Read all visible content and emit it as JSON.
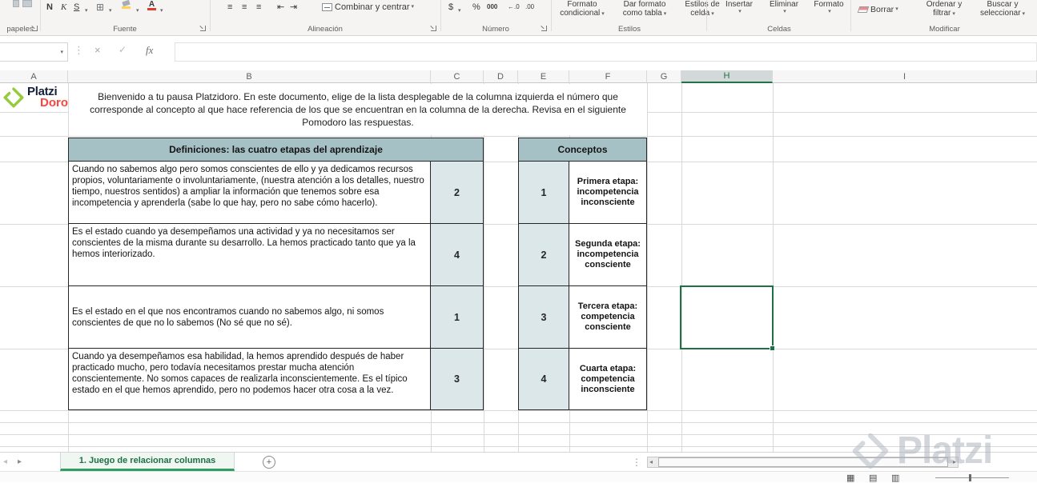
{
  "ribbon": {
    "groups": {
      "clipboard": "papeles",
      "font": "Fuente",
      "alignment": "Alineación",
      "number": "Número",
      "styles": "Estilos",
      "cells": "Celdas",
      "editing": "Modificar"
    },
    "buttons": {
      "bold": "N",
      "italic": "K",
      "underline": "S",
      "merge_center": "Combinar y centrar",
      "currency": "$",
      "percent": "%",
      "thousands": "000",
      "conditional_formatting": "Formato condicional",
      "format_as_table": "Dar formato como tabla",
      "cell_styles": "Estilos de celda",
      "insert": "Insertar",
      "delete": "Eliminar",
      "format": "Formato",
      "clear": "Borrar",
      "sort_filter": "Ordenar y filtrar",
      "find_select": "Buscar y seleccionar"
    }
  },
  "formula_bar": {
    "name_box_value": "",
    "formula_value": "",
    "insert_function": "fx"
  },
  "icons": {
    "dropdown": "▾",
    "cancel": "×",
    "enter": "✓",
    "borders": "⊞",
    "align_lines": "≡",
    "indent_decrease": "⇤",
    "indent_increase": "⇥",
    "increase_decimal": "←.0",
    "decrease_decimal": ".00",
    "font_color_letter": "A",
    "nav_left": "◂",
    "nav_right": "▸",
    "scroll_left": "◂",
    "scroll_right": "▸",
    "add_sheet": "+",
    "splitter": "⋮",
    "view_normal": "▦",
    "view_layout": "▤",
    "view_break": "▥"
  },
  "column_headers": [
    "A",
    "B",
    "C",
    "D",
    "E",
    "F",
    "G",
    "H",
    "I"
  ],
  "selection": {
    "column": "H"
  },
  "logo": {
    "brand": "Platzi",
    "product": "Doro"
  },
  "instructions": "Bienvenido a tu pausa Platzidoro. En este documento, elige de la lista desplegable de la columna izquierda el número que corresponde al concepto al que hace referencia de los que se encuentran en la columna de la derecha. Revisa en el siguiente Pomodoro las respuestas.",
  "definitions_table": {
    "title": "Definiciones: las cuatro etapas del aprendizaje",
    "rows": [
      {
        "definition": "Cuando no sabemos algo pero somos conscientes de ello y ya dedicamos recursos propios, voluntariamente o involuntariamente, (nuestra atención a los detalles, nuestro tiempo, nuestros sentidos) a ampliar la información que tenemos sobre esa incompetencia y aprenderla (sabe lo que hay, pero no sabe cómo hacerlo).",
        "answer": "2"
      },
      {
        "definition": "Es el estado cuando ya desempeñamos una actividad y ya no necesitamos ser conscientes de la misma durante su desarrollo. La hemos practicado tanto que ya la hemos interiorizado.",
        "answer": "4"
      },
      {
        "definition": "Es el estado en el que nos encontramos cuando no sabemos algo, ni somos conscientes de que no lo sabemos (No sé que no sé).",
        "answer": "1"
      },
      {
        "definition": "Cuando ya desempeñamos esa habilidad, la hemos aprendido después de haber practicado mucho, pero todavía necesitamos prestar mucha atención conscientemente. No somos capaces de realizarla inconscientemente. Es el típico estado en el que hemos aprendido, pero no podemos hacer otra cosa a la vez.",
        "answer": "3"
      }
    ]
  },
  "concepts_table": {
    "title": "Conceptos",
    "rows": [
      {
        "number": "1",
        "concept": "Primera etapa: incompetencia inconsciente"
      },
      {
        "number": "2",
        "concept": "Segunda etapa: incompetencia consciente"
      },
      {
        "number": "3",
        "concept": "Tercera etapa: competencia consciente"
      },
      {
        "number": "4",
        "concept": "Cuarta etapa: competencia inconsciente"
      }
    ]
  },
  "sheet_tabs": {
    "active_tab": "1. Juego de relacionar columnas"
  },
  "watermark": "Platzi",
  "colors": {
    "table_header_fill": "#a6c1c6",
    "value_cell_fill": "#dbe7e9",
    "excel_green": "#217346",
    "tab_underline": "#2e9e63",
    "platzi_green": "#98ca3f",
    "doro_red": "#f9463c"
  }
}
